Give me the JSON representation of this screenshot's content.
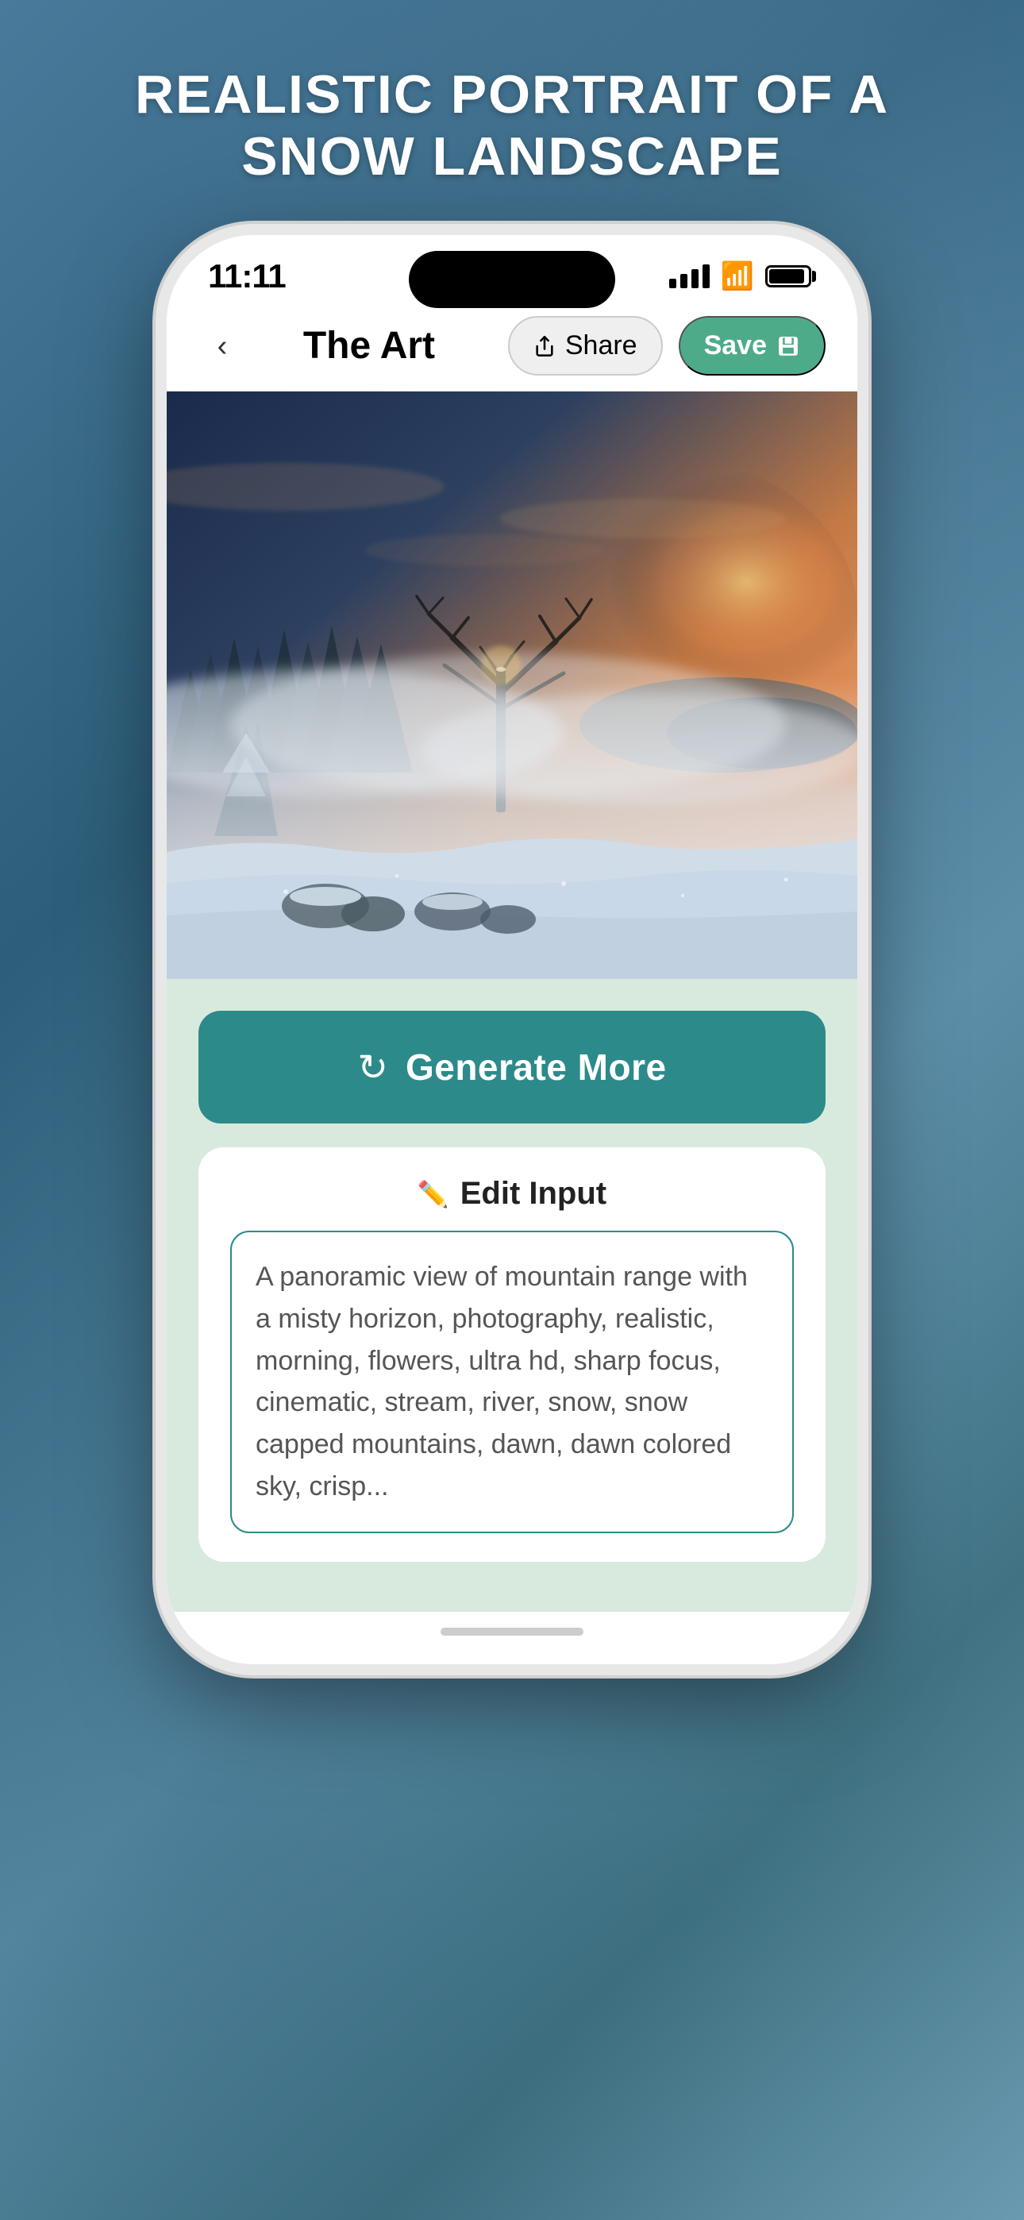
{
  "page": {
    "title": "REALISTIC PORTRAIT OF A\nSNOW LANDSCAPE"
  },
  "status_bar": {
    "time": "11:11",
    "signal": "signal",
    "wifi": "wifi",
    "battery": "battery"
  },
  "nav": {
    "back_label": "‹",
    "title": "The Art",
    "share_label": "Share",
    "save_label": "Save"
  },
  "generate": {
    "label": "Generate More",
    "icon": "↻"
  },
  "edit_input": {
    "title": "Edit Input",
    "pencil": "✏",
    "text": "A panoramic view of mountain range with a misty horizon, photography, realistic, morning, flowers, ultra hd, sharp focus, cinematic, stream, river, snow, snow capped mountains, dawn, dawn colored sky, crisp..."
  }
}
